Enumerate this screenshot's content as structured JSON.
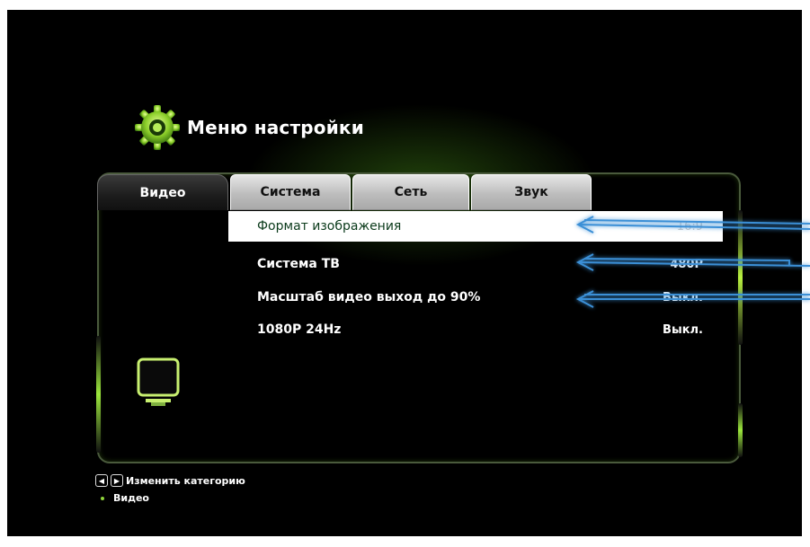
{
  "header": {
    "title": "Меню настройки",
    "icon": "gear-icon"
  },
  "tabs": [
    {
      "label": "Видео",
      "active": true
    },
    {
      "label": "Система",
      "active": false
    },
    {
      "label": "Сеть",
      "active": false
    },
    {
      "label": "Звук",
      "active": false
    }
  ],
  "settings": [
    {
      "label": "Формат изображения",
      "value": "16:9",
      "selected": true
    },
    {
      "label": "Система ТВ",
      "value": "480P",
      "selected": false
    },
    {
      "label": "Масштаб видео выход до 90%",
      "value": "Выкл.",
      "selected": false
    },
    {
      "label": "1080P 24Hz",
      "value": "Выкл.",
      "selected": false
    }
  ],
  "footer": {
    "hint": "Изменить категорию",
    "current": "Видео"
  },
  "colors": {
    "accent": "#9be63c",
    "arrow": "#3b8fd6",
    "background": "#000000"
  }
}
